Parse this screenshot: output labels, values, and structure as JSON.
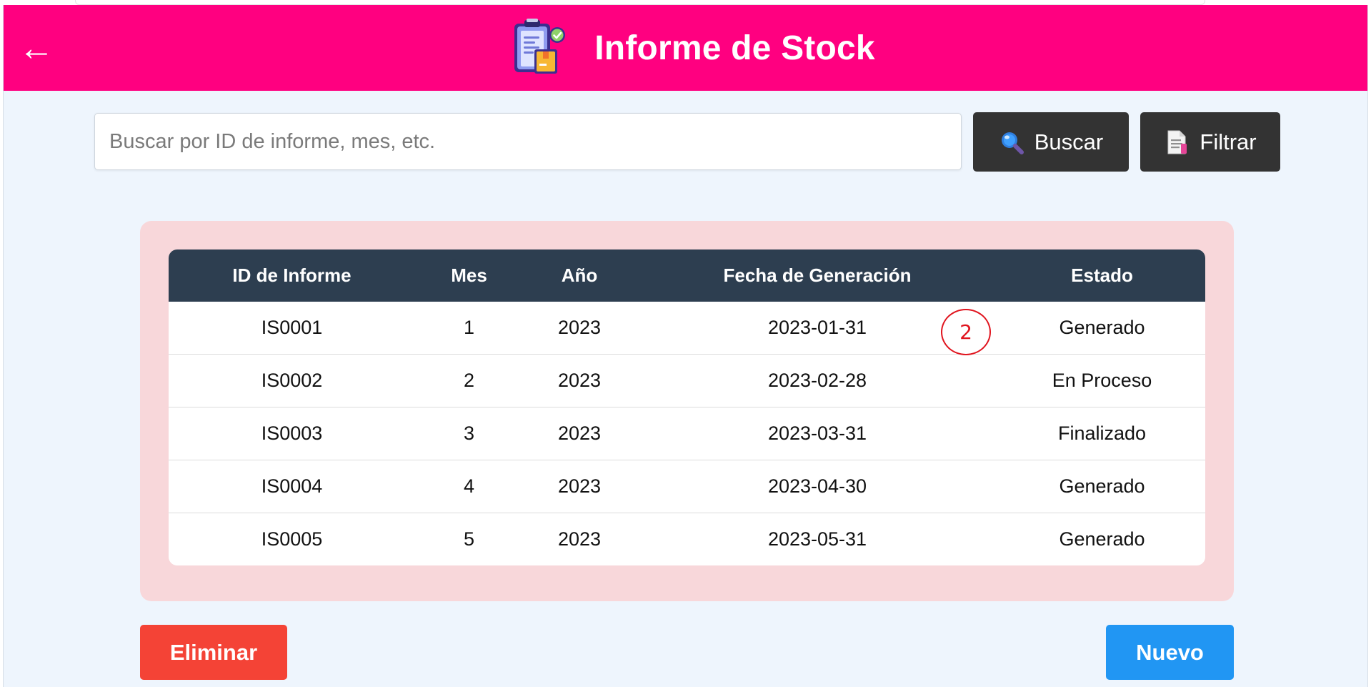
{
  "header": {
    "back_label": "←",
    "title": "Informe de Stock",
    "logo_icon": "clipboard-report-icon",
    "background_color": "#ff0080"
  },
  "search": {
    "placeholder": "Buscar por ID de informe, mes, etc.",
    "value": "",
    "search_button_label": "Buscar",
    "search_button_icon": "magnifier-icon",
    "filter_button_label": "Filtrar",
    "filter_button_icon": "document-icon"
  },
  "table": {
    "columns": [
      "ID de Informe",
      "Mes",
      "Año",
      "Fecha de Generación",
      "Estado"
    ],
    "rows": [
      [
        "IS0001",
        "1",
        "2023",
        "2023-01-31",
        "Generado"
      ],
      [
        "IS0002",
        "2",
        "2023",
        "2023-02-28",
        "En Proceso"
      ],
      [
        "IS0003",
        "3",
        "2023",
        "2023-03-31",
        "Finalizado"
      ],
      [
        "IS0004",
        "4",
        "2023",
        "2023-04-30",
        "Generado"
      ],
      [
        "IS0005",
        "5",
        "2023",
        "2023-05-31",
        "Generado"
      ]
    ],
    "header_color": "#2d3e50",
    "card_color": "#f8d7da"
  },
  "annotation": {
    "label": "2",
    "color": "#e0141e"
  },
  "actions": {
    "delete_label": "Eliminar",
    "delete_color": "#f44336",
    "new_label": "Nuevo",
    "new_color": "#2196f3"
  }
}
